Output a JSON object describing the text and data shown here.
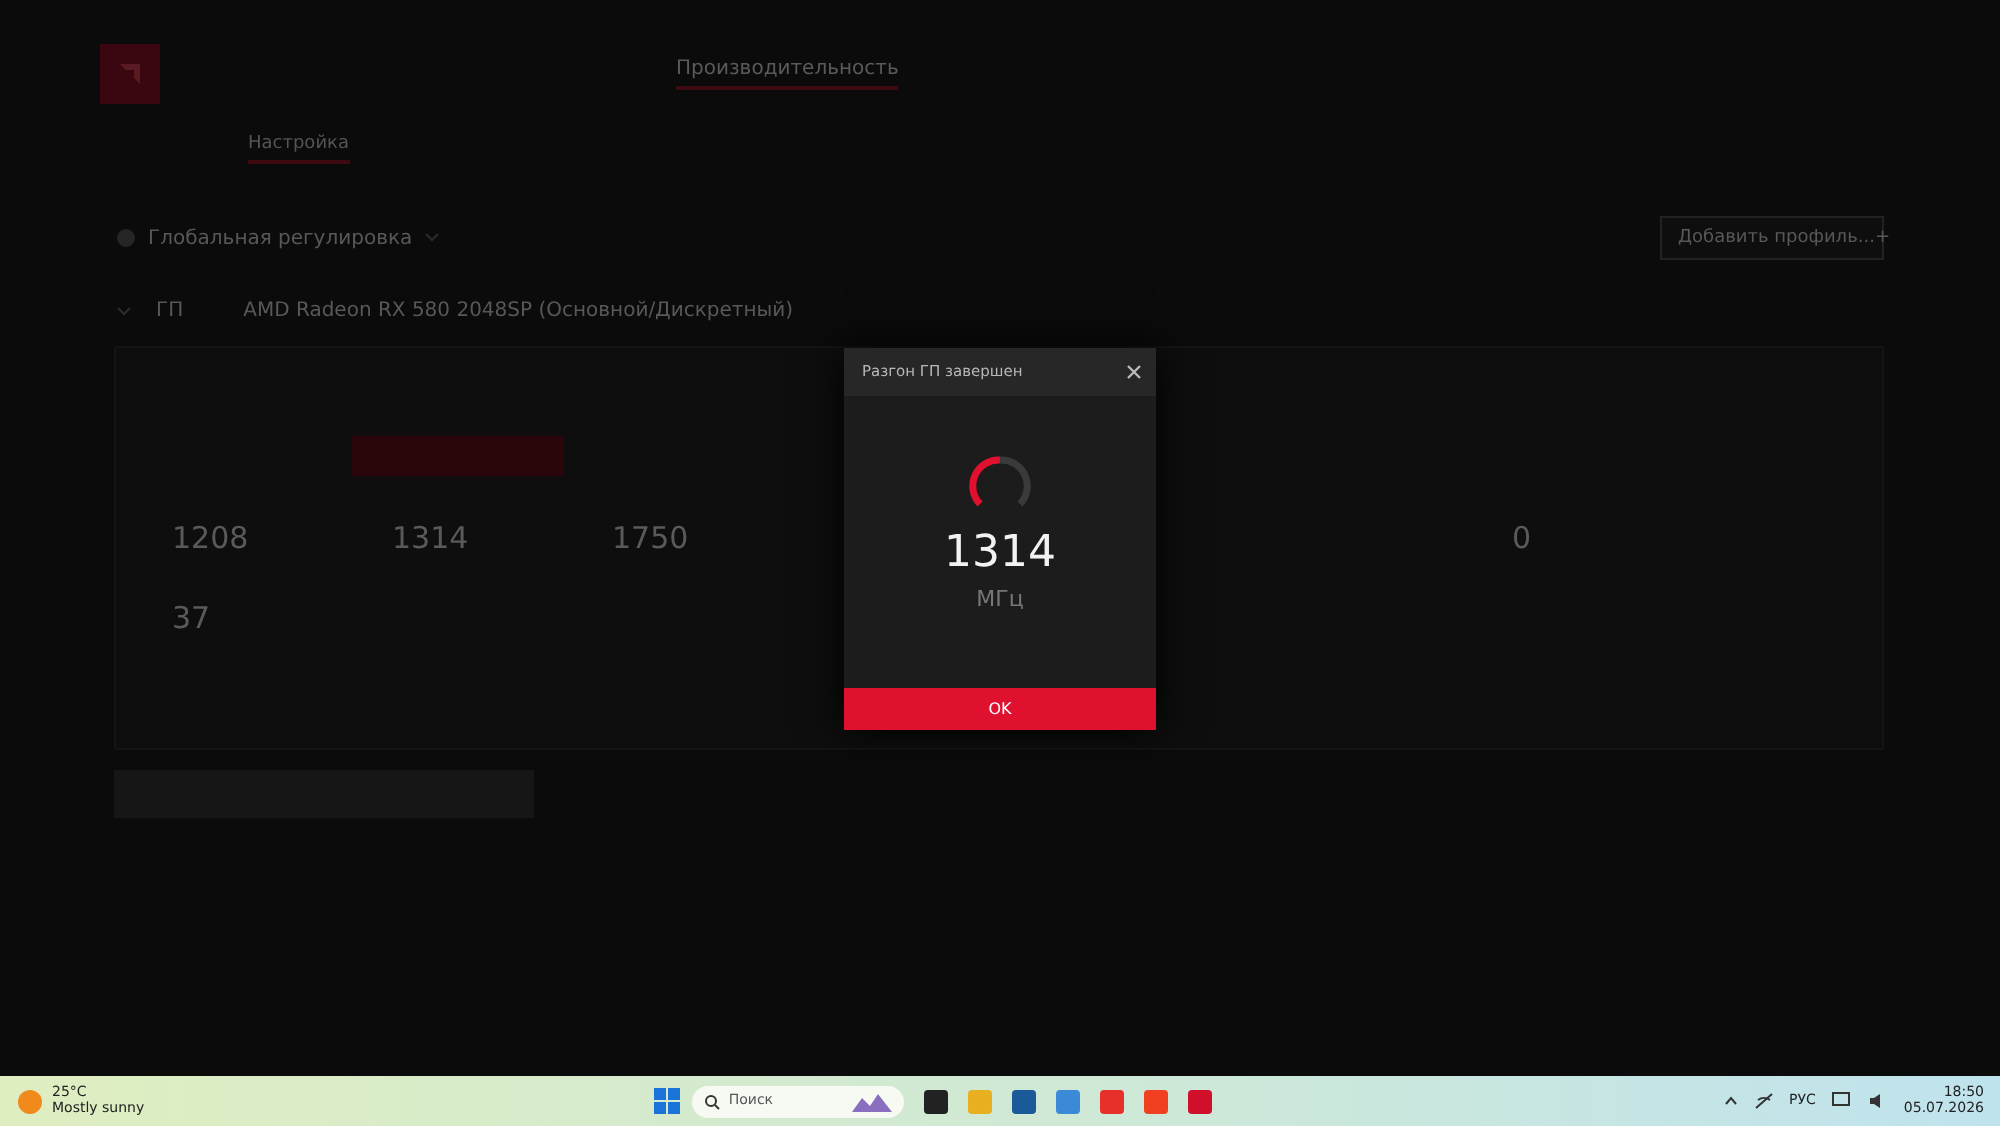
{
  "app": {
    "nav_active": "Производительность",
    "subtab_active": "Настройка",
    "profile_scope": "Глобальная регулировка",
    "add_profile": "Добавить профиль...",
    "add_icon": "+",
    "section": "ГП",
    "gpu_name": "AMD Radeon RX 580 2048SP (Основной/Дискретный)",
    "metrics_top": [
      {
        "value": "1208"
      },
      {
        "value": "1314"
      },
      {
        "value": "1750"
      },
      {
        "value": "0"
      }
    ],
    "metrics_bottom": [
      {
        "value": "37"
      }
    ]
  },
  "dialog": {
    "title": "Разгон ГП завершен",
    "value": "1314",
    "unit": "МГц",
    "ok": "OK"
  },
  "taskbar": {
    "temp": "25°C",
    "weather": "Mostly sunny",
    "search_placeholder": "Поиск",
    "language": "РУС",
    "time": "18:50",
    "date": "05.07.2026"
  }
}
